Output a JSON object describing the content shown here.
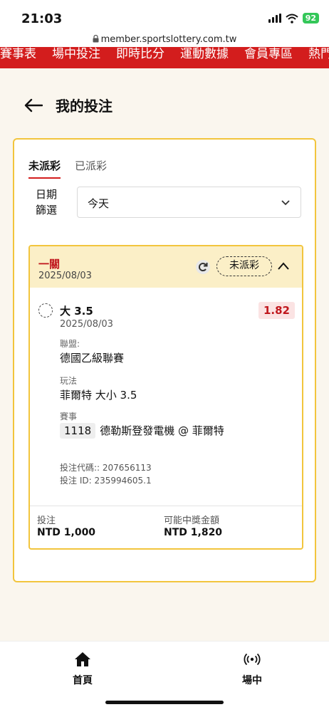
{
  "status_bar": {
    "time": "21:03",
    "battery": "92"
  },
  "browser": {
    "url": "member.sportslottery.com.tw"
  },
  "top_nav": {
    "items": [
      "賽事表",
      "場中投注",
      "即時比分",
      "運動數據",
      "會員專區",
      "熱門"
    ]
  },
  "header": {
    "title": "我的投注"
  },
  "tabs": [
    {
      "label": "未派彩",
      "active": true
    },
    {
      "label": "已派彩",
      "active": false
    }
  ],
  "filter": {
    "label": "日期篩選",
    "label_line1": "日期",
    "label_line2": "篩選",
    "value": "今天"
  },
  "bet": {
    "type": "一關",
    "date": "2025/08/03",
    "status": "未派彩",
    "selection": "大 3.5",
    "selection_date": "2025/08/03",
    "odds": "1.82",
    "league_label": "聯盟:",
    "league": "德國乙級聯賽",
    "market_label": "玩法",
    "market": "菲爾特 大小 3.5",
    "event_label": "賽事",
    "event_id": "1118",
    "event_name": "德勒斯登發電機 @ 菲爾特",
    "bet_code": "投注代碼:: 207656113",
    "bet_id": "投注 ID: 235994605.1",
    "stake_label": "投注",
    "stake": "NTD 1,000",
    "payout_label": "可能中獎金額",
    "payout": "NTD 1,820"
  },
  "bottom_nav": {
    "home": "首頁",
    "live": "場中"
  },
  "colors": {
    "brand_red": "#d31d1d",
    "accent_yellow": "#f2c53d",
    "odds_red": "#c0171d"
  },
  "icons": [
    "back-arrow-icon",
    "chevron-down-icon",
    "refresh-icon",
    "chevron-up-icon",
    "home-icon",
    "live-icon",
    "lock-icon"
  ]
}
